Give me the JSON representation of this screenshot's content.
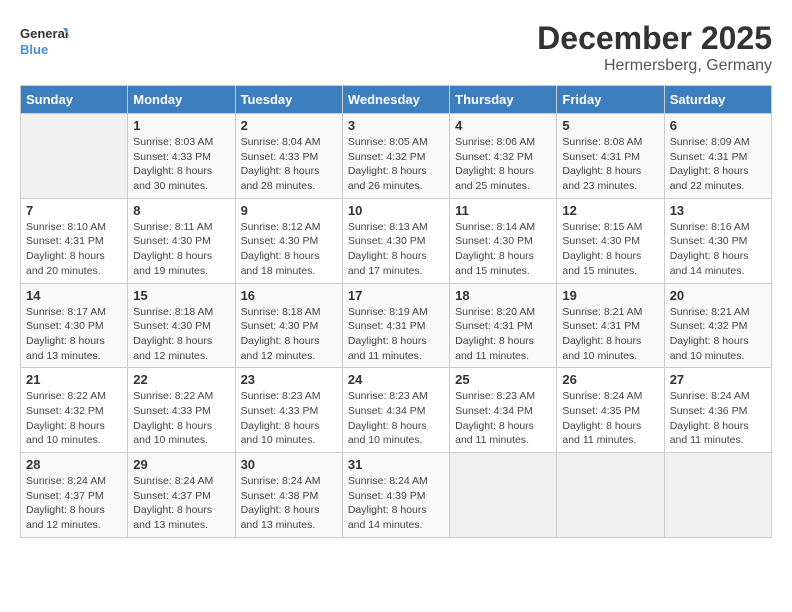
{
  "header": {
    "logo_line1": "General",
    "logo_line2": "Blue",
    "month": "December 2025",
    "location": "Hermersberg, Germany"
  },
  "days_of_week": [
    "Sunday",
    "Monday",
    "Tuesday",
    "Wednesday",
    "Thursday",
    "Friday",
    "Saturday"
  ],
  "weeks": [
    [
      {
        "day": "",
        "detail": ""
      },
      {
        "day": "1",
        "detail": "Sunrise: 8:03 AM\nSunset: 4:33 PM\nDaylight: 8 hours\nand 30 minutes."
      },
      {
        "day": "2",
        "detail": "Sunrise: 8:04 AM\nSunset: 4:33 PM\nDaylight: 8 hours\nand 28 minutes."
      },
      {
        "day": "3",
        "detail": "Sunrise: 8:05 AM\nSunset: 4:32 PM\nDaylight: 8 hours\nand 26 minutes."
      },
      {
        "day": "4",
        "detail": "Sunrise: 8:06 AM\nSunset: 4:32 PM\nDaylight: 8 hours\nand 25 minutes."
      },
      {
        "day": "5",
        "detail": "Sunrise: 8:08 AM\nSunset: 4:31 PM\nDaylight: 8 hours\nand 23 minutes."
      },
      {
        "day": "6",
        "detail": "Sunrise: 8:09 AM\nSunset: 4:31 PM\nDaylight: 8 hours\nand 22 minutes."
      }
    ],
    [
      {
        "day": "7",
        "detail": "Sunrise: 8:10 AM\nSunset: 4:31 PM\nDaylight: 8 hours\nand 20 minutes."
      },
      {
        "day": "8",
        "detail": "Sunrise: 8:11 AM\nSunset: 4:30 PM\nDaylight: 8 hours\nand 19 minutes."
      },
      {
        "day": "9",
        "detail": "Sunrise: 8:12 AM\nSunset: 4:30 PM\nDaylight: 8 hours\nand 18 minutes."
      },
      {
        "day": "10",
        "detail": "Sunrise: 8:13 AM\nSunset: 4:30 PM\nDaylight: 8 hours\nand 17 minutes."
      },
      {
        "day": "11",
        "detail": "Sunrise: 8:14 AM\nSunset: 4:30 PM\nDaylight: 8 hours\nand 15 minutes."
      },
      {
        "day": "12",
        "detail": "Sunrise: 8:15 AM\nSunset: 4:30 PM\nDaylight: 8 hours\nand 15 minutes."
      },
      {
        "day": "13",
        "detail": "Sunrise: 8:16 AM\nSunset: 4:30 PM\nDaylight: 8 hours\nand 14 minutes."
      }
    ],
    [
      {
        "day": "14",
        "detail": "Sunrise: 8:17 AM\nSunset: 4:30 PM\nDaylight: 8 hours\nand 13 minutes."
      },
      {
        "day": "15",
        "detail": "Sunrise: 8:18 AM\nSunset: 4:30 PM\nDaylight: 8 hours\nand 12 minutes."
      },
      {
        "day": "16",
        "detail": "Sunrise: 8:18 AM\nSunset: 4:30 PM\nDaylight: 8 hours\nand 12 minutes."
      },
      {
        "day": "17",
        "detail": "Sunrise: 8:19 AM\nSunset: 4:31 PM\nDaylight: 8 hours\nand 11 minutes."
      },
      {
        "day": "18",
        "detail": "Sunrise: 8:20 AM\nSunset: 4:31 PM\nDaylight: 8 hours\nand 11 minutes."
      },
      {
        "day": "19",
        "detail": "Sunrise: 8:21 AM\nSunset: 4:31 PM\nDaylight: 8 hours\nand 10 minutes."
      },
      {
        "day": "20",
        "detail": "Sunrise: 8:21 AM\nSunset: 4:32 PM\nDaylight: 8 hours\nand 10 minutes."
      }
    ],
    [
      {
        "day": "21",
        "detail": "Sunrise: 8:22 AM\nSunset: 4:32 PM\nDaylight: 8 hours\nand 10 minutes."
      },
      {
        "day": "22",
        "detail": "Sunrise: 8:22 AM\nSunset: 4:33 PM\nDaylight: 8 hours\nand 10 minutes."
      },
      {
        "day": "23",
        "detail": "Sunrise: 8:23 AM\nSunset: 4:33 PM\nDaylight: 8 hours\nand 10 minutes."
      },
      {
        "day": "24",
        "detail": "Sunrise: 8:23 AM\nSunset: 4:34 PM\nDaylight: 8 hours\nand 10 minutes."
      },
      {
        "day": "25",
        "detail": "Sunrise: 8:23 AM\nSunset: 4:34 PM\nDaylight: 8 hours\nand 11 minutes."
      },
      {
        "day": "26",
        "detail": "Sunrise: 8:24 AM\nSunset: 4:35 PM\nDaylight: 8 hours\nand 11 minutes."
      },
      {
        "day": "27",
        "detail": "Sunrise: 8:24 AM\nSunset: 4:36 PM\nDaylight: 8 hours\nand 11 minutes."
      }
    ],
    [
      {
        "day": "28",
        "detail": "Sunrise: 8:24 AM\nSunset: 4:37 PM\nDaylight: 8 hours\nand 12 minutes."
      },
      {
        "day": "29",
        "detail": "Sunrise: 8:24 AM\nSunset: 4:37 PM\nDaylight: 8 hours\nand 13 minutes."
      },
      {
        "day": "30",
        "detail": "Sunrise: 8:24 AM\nSunset: 4:38 PM\nDaylight: 8 hours\nand 13 minutes."
      },
      {
        "day": "31",
        "detail": "Sunrise: 8:24 AM\nSunset: 4:39 PM\nDaylight: 8 hours\nand 14 minutes."
      },
      {
        "day": "",
        "detail": ""
      },
      {
        "day": "",
        "detail": ""
      },
      {
        "day": "",
        "detail": ""
      }
    ]
  ]
}
